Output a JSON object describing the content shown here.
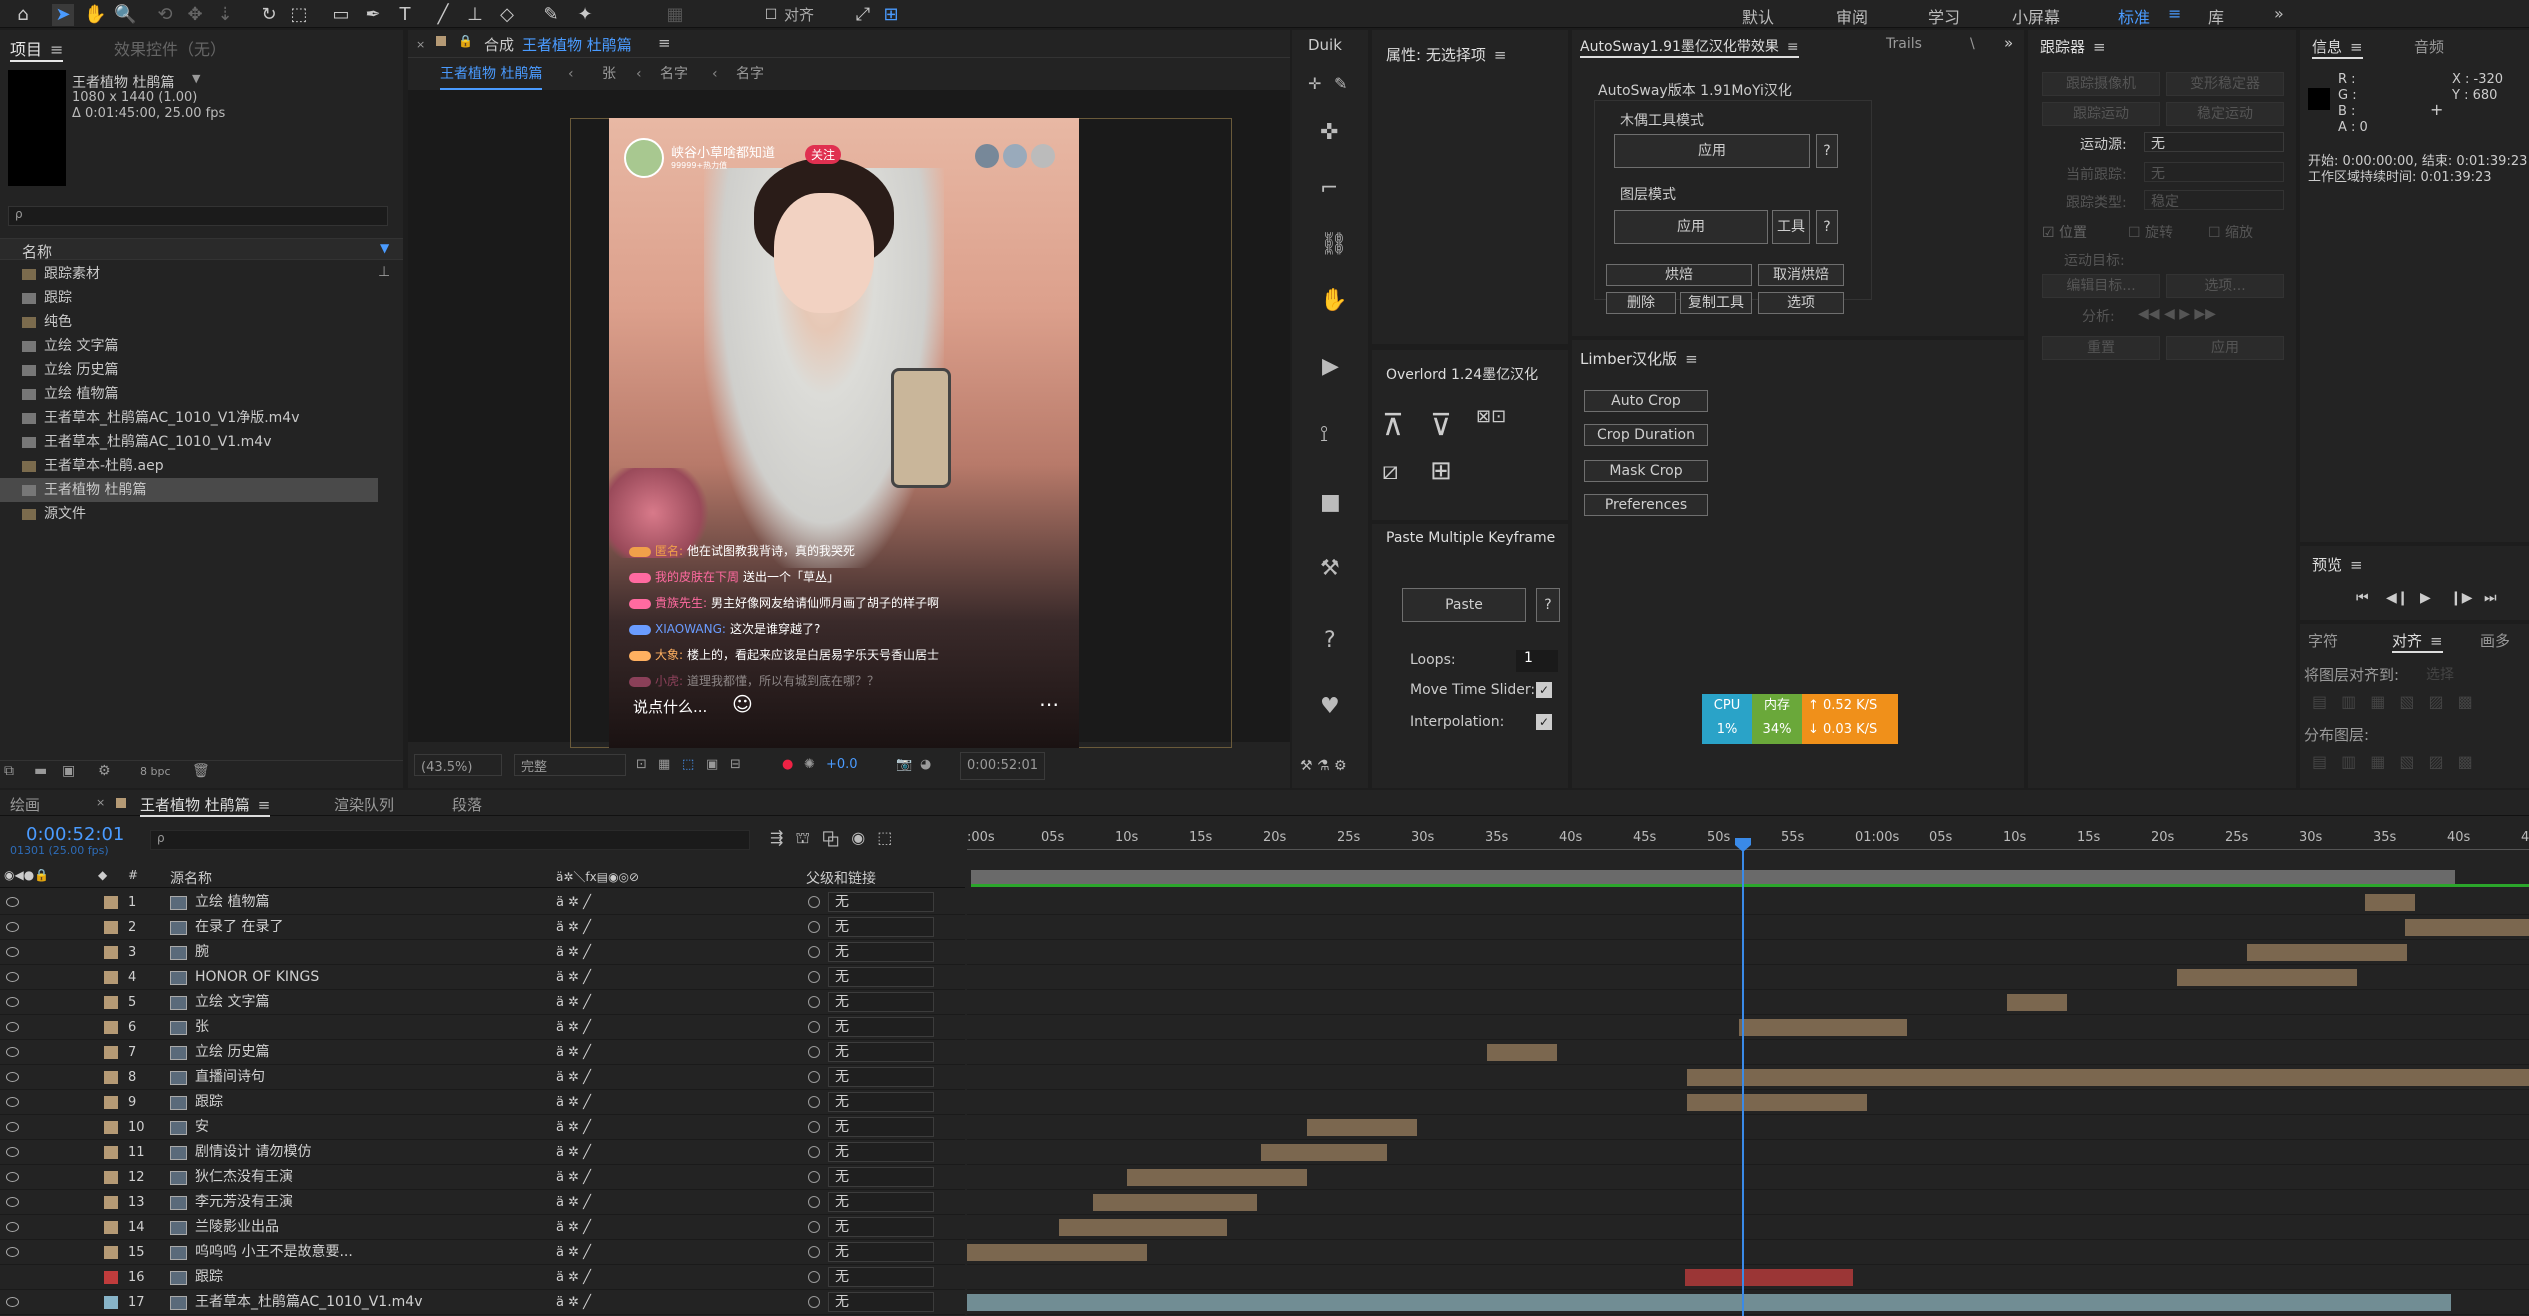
{
  "workspaces": [
    "默认",
    "审阅",
    "学习",
    "小屏幕",
    "标准",
    "库"
  ],
  "toolbar": {
    "align_label": "对齐"
  },
  "project": {
    "tab": "项目",
    "effects_tab": "效果控件（无）",
    "comp_name": "王者植物 杜鹃篇",
    "comp_res": "1080 x 1440 (1.00)",
    "comp_dur": "Δ 0:01:45:00, 25.00 fps",
    "col_name": "名称",
    "search_placeholder": "ρ",
    "items": [
      {
        "t": "跟踪素材",
        "k": "folder"
      },
      {
        "t": "跟踪",
        "k": "comp"
      },
      {
        "t": "纯色",
        "k": "folder"
      },
      {
        "t": "立绘 文字篇",
        "k": "comp"
      },
      {
        "t": "立绘 历史篇",
        "k": "comp"
      },
      {
        "t": "立绘 植物篇",
        "k": "comp"
      },
      {
        "t": "王者草本_杜鹃篇AC_1010_V1净版.m4v",
        "k": "file"
      },
      {
        "t": "王者草本_杜鹃篇AC_1010_V1.m4v",
        "k": "file"
      },
      {
        "t": "王者草本-杜鹃.aep",
        "k": "folder"
      },
      {
        "t": "王者植物 杜鹃篇",
        "k": "comp",
        "sel": true
      },
      {
        "t": "源文件",
        "k": "folder"
      }
    ],
    "bpc": "8 bpc"
  },
  "comp": {
    "tab_prefix": "合成",
    "tab_name": "王者植物 杜鹃篇",
    "crumbs": [
      "王者植物 杜鹃篇",
      "张",
      "名字",
      "名字"
    ],
    "zoom": "(43.5%)",
    "quality": "完整",
    "exposure": "+0.0",
    "timecode": "0:00:52:01"
  },
  "video": {
    "channel": "峡谷小草啥都知道",
    "fans": "99999+热力值",
    "follow": "关注",
    "input_hint": "说点什么...",
    "chats": [
      {
        "n": "匿名:",
        "t": "他在试图教我背诗，真的我哭死",
        "c": "#f0a04a"
      },
      {
        "n": "我的皮肤在下周",
        "t": "送出一个「草丛」",
        "c": "#ff6aa0"
      },
      {
        "n": "貴族先生:",
        "t": "男主好像网友给请仙师月画了胡子的样子啊",
        "c": "#ff6aa0"
      },
      {
        "n": "XIAOWANG:",
        "t": "这次是谁穿越了?",
        "c": "#6a9cff"
      },
      {
        "n": "大象:",
        "t": "楼上的，看起来应该是白居易字乐天号香山居士",
        "c": "#ffb060"
      },
      {
        "n": "小虎:",
        "t": "道理我都懂，所以有城到底在哪？？",
        "c": "#ff6aa0"
      }
    ]
  },
  "duik": {
    "title": "Duik"
  },
  "props": {
    "title": "属性: 无选择项"
  },
  "overlord": {
    "title": "Overlord 1.24墨亿汉化"
  },
  "paste": {
    "title": "Paste Multiple Keyframe",
    "btn": "Paste",
    "help": "?",
    "loops_label": "Loops:",
    "loops": "1",
    "slider_label": "Move Time Slider:",
    "interp_label": "Interpolation:"
  },
  "autosway": {
    "tab": "AutoSway1.91墨亿汉化带效果",
    "tab2": "Trails",
    "tab3": "\\",
    "version": "AutoSway版本 1.91MoYi汉化",
    "puppet": "木偶工具模式",
    "apply": "应用",
    "help": "?",
    "layer": "图层模式",
    "apply2": "应用",
    "tool": "工具",
    "bake": "烘焙",
    "unbake": "取消烘焙",
    "del": "删除",
    "copytool": "复制工具",
    "opts": "选项"
  },
  "limber": {
    "title": "Limber汉化版",
    "btns": [
      "Auto Crop",
      "Crop Duration",
      "Mask Crop",
      "Preferences"
    ]
  },
  "cpu": {
    "cpu": "CPU",
    "cpu_val": "1%",
    "mem": "内存",
    "mem_val": "34%",
    "up": "0.52 K/S",
    "down": "0.03 K/S"
  },
  "tracker": {
    "title": "跟踪器",
    "b1": "跟踪摄像机",
    "b2": "变形稳定器",
    "b3": "跟踪运动",
    "b4": "稳定运动",
    "src_label": "运动源:",
    "src": "无",
    "cur_label": "当前跟踪:",
    "cur": "无",
    "type_label": "跟踪类型:",
    "type": "稳定",
    "c1": "位置",
    "c2": "旋转",
    "c3": "缩放",
    "target": "运动目标:",
    "edit": "编辑目标...",
    "opts": "选项...",
    "analyze": "分析:",
    "reset": "重置",
    "apply": "应用"
  },
  "info": {
    "title": "信息",
    "audio": "音频",
    "r": "R :",
    "g": "G :",
    "b": "B :",
    "a": "A : 0",
    "x": "X : -320",
    "y": "Y : 680",
    "start": "开始: 0:00:00:00, 结束: 0:01:39:23",
    "dur": "工作区域持续时间: 0:01:39:23"
  },
  "preview": {
    "title": "预览"
  },
  "chars": {
    "title": "字符",
    "align": "对齐",
    "para": "画多",
    "align_to": "将图层对齐到:",
    "select": "选择",
    "distribute": "分布图层:"
  },
  "timeline": {
    "tab_paint": "绘画",
    "tab_comp": "王者植物 杜鹃篇",
    "tab_render": "渲染队列",
    "tab_para": "段落",
    "timecode": "0:00:52:01",
    "frames": "01301 (25.00 fps)",
    "col_src": "源名称",
    "col_parent": "父级和链接",
    "ruler": [
      ":00s",
      "05s",
      "10s",
      "15s",
      "20s",
      "25s",
      "30s",
      "35s",
      "40s",
      "45s",
      "50s",
      "55s",
      "01:00s",
      "05s",
      "10s",
      "15s",
      "20s",
      "25s",
      "30s",
      "35s",
      "40s",
      "45"
    ],
    "layers": [
      {
        "n": "1",
        "name": "立绘 植物篇",
        "col": "#b59a75",
        "p": "无"
      },
      {
        "n": "2",
        "name": "在录了 在录了",
        "col": "#b59a75",
        "p": "无"
      },
      {
        "n": "3",
        "name": "腕",
        "col": "#b59a75",
        "p": "无"
      },
      {
        "n": "4",
        "name": "HONOR OF KINGS",
        "col": "#b59a75",
        "p": "无"
      },
      {
        "n": "5",
        "name": "立绘 文字篇",
        "col": "#b59a75",
        "p": "无"
      },
      {
        "n": "6",
        "name": "张",
        "col": "#b59a75",
        "p": "无"
      },
      {
        "n": "7",
        "name": "立绘 历史篇",
        "col": "#b59a75",
        "p": "无"
      },
      {
        "n": "8",
        "name": "直播间诗句",
        "col": "#b59a75",
        "p": "无"
      },
      {
        "n": "9",
        "name": "跟踪",
        "col": "#b59a75",
        "p": "无"
      },
      {
        "n": "10",
        "name": "安",
        "col": "#b59a75",
        "p": "无"
      },
      {
        "n": "11",
        "name": "剧情设计 请勿模仿",
        "col": "#b59a75",
        "p": "无"
      },
      {
        "n": "12",
        "name": "狄仁杰没有王演",
        "col": "#b59a75",
        "p": "无"
      },
      {
        "n": "13",
        "name": "李元芳没有王演",
        "col": "#b59a75",
        "p": "无"
      },
      {
        "n": "14",
        "name": "兰陵影业出品",
        "col": "#b59a75",
        "p": "无"
      },
      {
        "n": "15",
        "name": "呜呜呜 小王不是故意要...",
        "col": "#b59a75",
        "p": "无"
      },
      {
        "n": "16",
        "name": "跟踪",
        "col": "#c03c3c",
        "p": "无"
      },
      {
        "n": "17",
        "name": "王者草本_杜鹃篇AC_1010_V1.m4v",
        "col": "#88b4c8",
        "p": "无"
      }
    ]
  }
}
